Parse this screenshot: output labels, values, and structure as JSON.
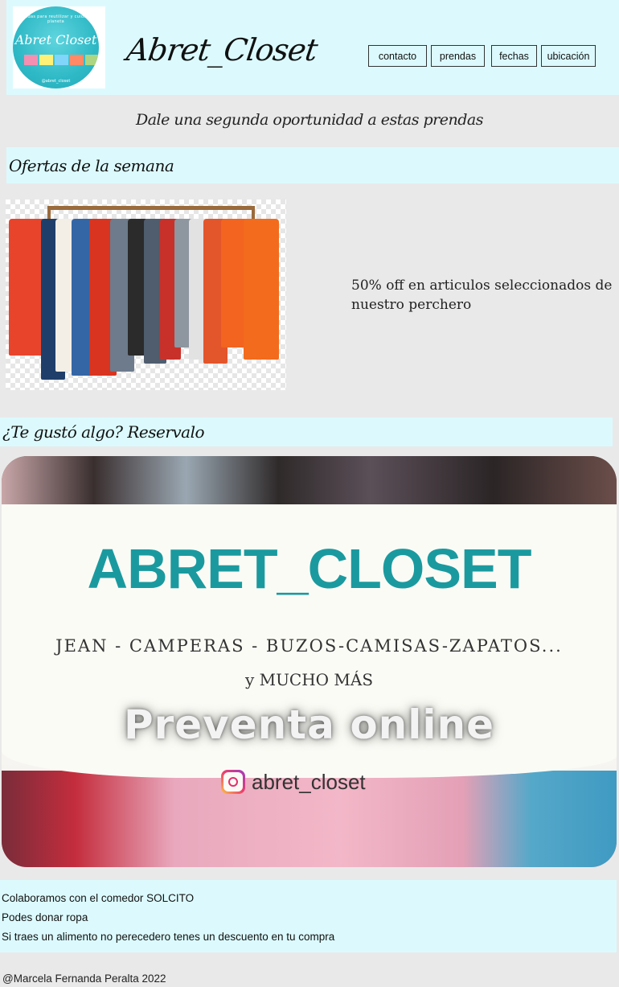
{
  "header": {
    "logo": {
      "top_text": "prendas para reutilizar y cuidar el planeta",
      "script": "Abret Closet",
      "bottom_text": "@abret_closet",
      "shirt_colors": [
        "#f48fb1",
        "#fff176",
        "#81d4fa",
        "#ff8a65",
        "#aed581"
      ]
    },
    "title": "Abret_Closet",
    "nav": [
      {
        "label": "contacto"
      },
      {
        "label": "prendas"
      },
      {
        "label": "fechas"
      },
      {
        "label": "ubicación"
      }
    ]
  },
  "tagline": "Dale una segunda oportunidad a estas prendas",
  "offers": {
    "heading": "Ofertas de la semana",
    "text": "50% off en articulos seleccionados de nuestro perchero"
  },
  "reserve": {
    "heading": "¿Te gustó algo? Reservalo"
  },
  "promo": {
    "brand": "ABRET_CLOSET",
    "subtitle": "JEAN - CAMPERAS - BUZOS-CAMISAS-ZAPATOS...",
    "more": "y MUCHO MÁS",
    "headline": "Preventa online",
    "instagram": "abret_closet"
  },
  "info": {
    "lines": [
      "Colaboramos con el comedor SOLCITO",
      "Podes donar ropa",
      "Si traes un alimento no perecedero tenes un descuento en tu compra"
    ]
  },
  "footer": "@Marcela Fernanda Peralta 2022",
  "colors": {
    "accent_bg": "#dcfafd",
    "page_bg": "#e9e9e9",
    "brand_teal": "#1a9a9f"
  }
}
